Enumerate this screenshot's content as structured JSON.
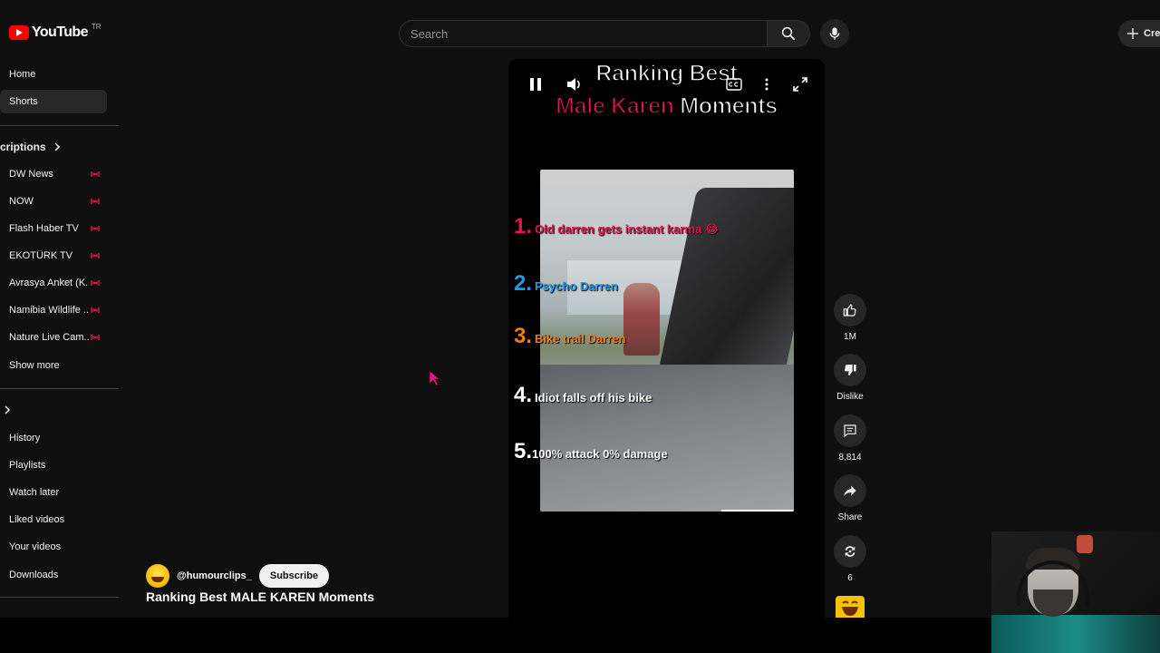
{
  "header": {
    "logo_text": "YouTube",
    "logo_region": "TR",
    "search_placeholder": "Search",
    "create_label": "Cre"
  },
  "sidebar": {
    "primary": [
      {
        "label": "Home",
        "active": false
      },
      {
        "label": "Shorts",
        "active": true
      }
    ],
    "subscriptions_heading": "criptions",
    "subscriptions": [
      {
        "label": "DW News",
        "live": true
      },
      {
        "label": "NOW",
        "live": true
      },
      {
        "label": "Flash Haber TV",
        "live": true
      },
      {
        "label": "EKOTÜRK TV",
        "live": true
      },
      {
        "label": "Avrasya Anket (K...",
        "live": true
      },
      {
        "label": "Namibia Wildlife ...",
        "live": true
      },
      {
        "label": "Nature Live Cam...",
        "live": true
      }
    ],
    "show_more": "Show more",
    "you_items": [
      {
        "label": "History"
      },
      {
        "label": "Playlists"
      },
      {
        "label": "Watch later"
      },
      {
        "label": "Liked videos"
      },
      {
        "label": "Your videos"
      },
      {
        "label": "Downloads"
      }
    ],
    "live_color": "#e2184a"
  },
  "short": {
    "overlay_line1": "Ranking Best",
    "overlay_line2_red": "Male Karen",
    "overlay_line2_white": "Moments",
    "rankings": [
      {
        "num": "1.",
        "text": "Old darren gets instant karma 😂",
        "num_color": "#e8134f",
        "text_color": "#e8134f"
      },
      {
        "num": "2.",
        "text": "Psycho Darren",
        "num_color": "#1e9be8",
        "text_color": "#1e9be8"
      },
      {
        "num": "3.",
        "text": "Bike trail Darren",
        "num_color": "#f07b12",
        "text_color": "#f07b12"
      },
      {
        "num": "4.",
        "text": "Idiot falls off his bike",
        "num_color": "#ffffff",
        "text_color": "#ffffff"
      },
      {
        "num": "5.",
        "text": "100% attack 0% damage",
        "num_color": "#ffffff",
        "text_color": "#ffffff"
      }
    ]
  },
  "actions": {
    "like_count": "1M",
    "dislike_label": "Dislike",
    "comment_count": "8,814",
    "share_label": "Share",
    "remix_count": "6"
  },
  "channel": {
    "handle": "@humourclips_",
    "subscribe_label": "Subscribe",
    "video_title": "Ranking Best MALE KAREN Moments"
  },
  "colors": {
    "background": "#0f0f0f",
    "accent_red": "#ff0000"
  }
}
